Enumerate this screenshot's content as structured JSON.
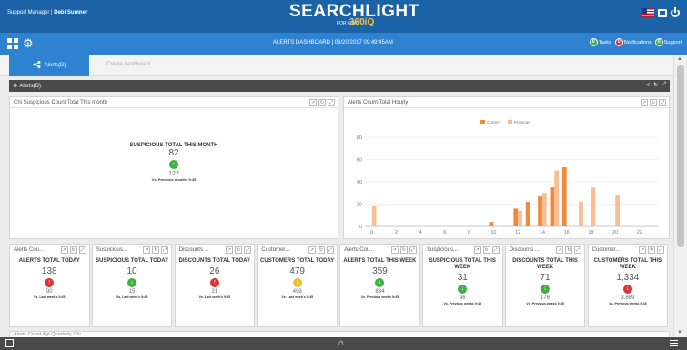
{
  "header": {
    "left_text": "Support Manager | ",
    "user_name": "Debi Sumner",
    "brand_main": "SEARCHLIGHT",
    "brand_sub": "FOR QSR",
    "brand_360": "360iQ"
  },
  "subbar": {
    "title": "ALERTS DASHBOARD | 06/20/2017 09:49:45AM",
    "pills": [
      {
        "label": "Tasks",
        "color": "#3cb043",
        "badge": "0"
      },
      {
        "label": "Notifications",
        "color": "#e03232",
        "badge": "0"
      },
      {
        "label": "Support",
        "color": "#3cb043",
        "badge": "0"
      }
    ]
  },
  "tabs": {
    "active": "Alerts(D)",
    "inactive": "Create dashboard"
  },
  "section": {
    "title": "Alerts(D)"
  },
  "panel_left": {
    "header": "Chi Suspicious Count Total This month",
    "kpi_title": "SUSPICIOUS TOTAL THIS MONTH",
    "value": "82",
    "previous": "122",
    "note": "Vs. Previous months 9:45",
    "trend": "down",
    "trend_color": "#3cb043"
  },
  "panel_chart": {
    "header": "Alerts Count Total Hourly"
  },
  "chart_data": {
    "type": "bar",
    "series": [
      {
        "name": "Current",
        "color": "#f08a3c",
        "values": [
          0,
          0,
          0,
          0,
          0,
          0,
          0,
          0,
          0,
          0,
          4,
          0,
          16,
          22,
          27,
          35,
          53,
          0,
          0,
          0,
          0,
          0,
          0,
          0
        ]
      },
      {
        "name": "Previous",
        "color": "#f8bf93",
        "values": [
          18,
          0,
          0,
          0,
          0,
          0,
          0,
          0,
          0,
          0,
          0,
          0,
          14,
          0,
          30,
          50,
          0,
          22,
          35,
          0,
          28,
          0,
          0,
          0
        ]
      }
    ],
    "x": [
      0,
      1,
      2,
      3,
      4,
      5,
      6,
      7,
      8,
      9,
      10,
      11,
      12,
      13,
      14,
      15,
      16,
      17,
      18,
      19,
      20,
      21,
      22,
      23
    ],
    "xticks": [
      0,
      2,
      4,
      6,
      8,
      10,
      12,
      14,
      16,
      18,
      20,
      22
    ],
    "yticks": [
      0,
      20,
      40,
      60,
      80
    ],
    "ylim": [
      0,
      80
    ],
    "legend": "top-center",
    "grid": true
  },
  "cards": [
    {
      "header": "Alerts Cou...",
      "title": "ALERTS TOTAL TODAY",
      "value": "138",
      "previous": "90",
      "note": "Vs. Last week's 9:45",
      "trend": "up",
      "color": "#e03232"
    },
    {
      "header": "Suspicious...",
      "title": "SUSPICIOUS TOTAL TODAY",
      "value": "10",
      "previous": "15",
      "note": "Vs. Last week's 9:45",
      "trend": "down",
      "color": "#3cb043"
    },
    {
      "header": "Discounts ...",
      "title": "DISCOUNTS TOTAL TODAY",
      "value": "26",
      "previous": "21",
      "note": "Vs. Last week's 9:45",
      "trend": "up",
      "color": "#e03232"
    },
    {
      "header": "Customer...",
      "title": "CUSTOMERS TOTAL TODAY",
      "value": "479",
      "previous": "498",
      "note": "Vs. Last week's 9:45",
      "trend": "down",
      "color": "#e6c229"
    },
    {
      "header": "Alerts Cou...",
      "title": "ALERTS TOTAL THIS WEEK",
      "value": "359",
      "previous": "834",
      "note": "Vs. Previous weeks 9:45",
      "trend": "down",
      "color": "#3cb043"
    },
    {
      "header": "Suspicious...",
      "title": "SUSPICIOUS TOTAL THIS WEEK",
      "value": "31",
      "previous": "96",
      "note": "Vs. Previous weeks 9:45",
      "trend": "down",
      "color": "#3cb043"
    },
    {
      "header": "Discounts ...",
      "title": "DISCOUNTS TOTAL THIS WEEK",
      "value": "71",
      "previous": "176",
      "note": "Vs. Previous weeks 9:45",
      "trend": "down",
      "color": "#3cb043"
    },
    {
      "header": "Customer...",
      "title": "CUSTOMERS TOTAL THIS WEEK",
      "value": "1,334",
      "previous": "3,689",
      "note": "Vs. Previous weeks 9:45",
      "trend": "down",
      "color": "#e03232"
    }
  ],
  "bottom_panel": {
    "header": "Alerts Count Agt Quarterly Chi"
  }
}
